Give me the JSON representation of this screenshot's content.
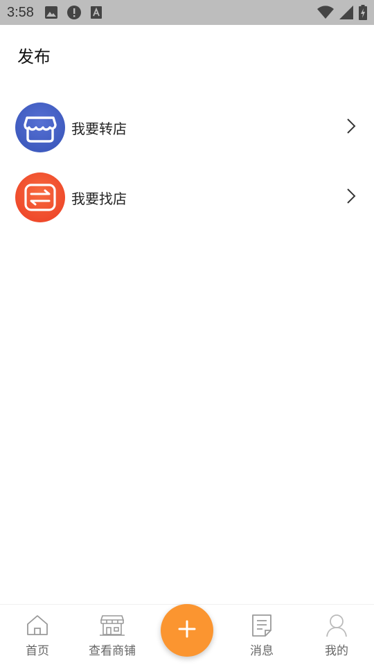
{
  "status_bar": {
    "time": "3:58",
    "left_icons": [
      "image-icon",
      "alert-icon",
      "font-icon"
    ],
    "right_icons": [
      "wifi-icon",
      "signal-icon",
      "battery-icon"
    ]
  },
  "header": {
    "title": "发布"
  },
  "menu": {
    "items": [
      {
        "label": "我要转店",
        "icon": "storefront-icon",
        "color": "#3f5bbf"
      },
      {
        "label": "我要找店",
        "icon": "swap-icon",
        "color": "#f0512f"
      }
    ]
  },
  "bottom_nav": {
    "items": [
      {
        "label": "首页",
        "icon": "home-icon"
      },
      {
        "label": "查看商铺",
        "icon": "shop-icon"
      },
      {
        "label": "消息",
        "icon": "document-icon"
      },
      {
        "label": "我的",
        "icon": "user-icon"
      }
    ],
    "fab_icon": "plus-icon",
    "fab_color": "#fb9530"
  }
}
